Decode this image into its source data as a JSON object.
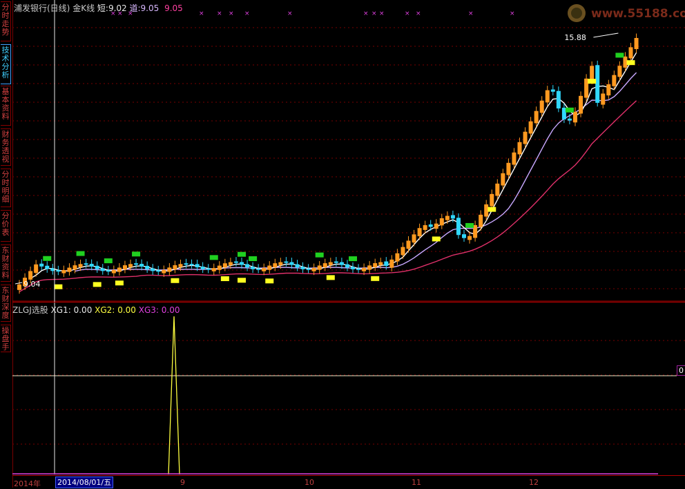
{
  "sidebar": {
    "tabs": [
      {
        "label": "分时走势",
        "active": false
      },
      {
        "label": "技术分析",
        "active": true
      },
      {
        "label": "基本资料",
        "active": false
      },
      {
        "label": "财务透视",
        "active": false
      },
      {
        "label": "分时明细",
        "active": false
      },
      {
        "label": "分价表",
        "active": false
      },
      {
        "label": "东财资料",
        "active": false
      },
      {
        "label": "东财深度",
        "active": false
      },
      {
        "label": "操盘手",
        "active": false
      }
    ]
  },
  "main": {
    "stock_title": "浦发银行(日线)",
    "indicator_name": "金K线",
    "short_label": "短:",
    "short_value": "9.02",
    "dao_label": "道:",
    "dao_value": "9.05",
    "third_value": "9.05",
    "high_marker": "15.88",
    "low_marker": "9.04"
  },
  "indicator": {
    "name": "ZLGJ选股",
    "xg1_label": "XG1:",
    "xg1_value": "0.00",
    "xg2_label": "XG2:",
    "xg2_value": "0.00",
    "xg3_label": "XG3:",
    "xg3_value": "0.00",
    "right_value": "0"
  },
  "xaxis": {
    "year_label": "2014年",
    "cursor_date": "2014/08/01/五",
    "months": [
      "9",
      "10",
      "11",
      "12"
    ]
  },
  "logo": {
    "text": "www.55188.com"
  },
  "colors": {
    "up": "#ff9a20",
    "down": "#30d8ff",
    "ma1": "#ffffff",
    "ma2": "#c8a8ff",
    "ma3": "#e0306a",
    "green_mark": "#20d020",
    "yellow_mark": "#ffff20",
    "grid": "#7a0000"
  },
  "chart_data": {
    "type": "candlestick",
    "title": "浦发银行(日线)",
    "price_range": [
      9.04,
      15.88
    ],
    "series": [
      {
        "name": "短",
        "last": 9.02
      },
      {
        "name": "道",
        "last": 9.05
      }
    ],
    "indicator_series": [
      {
        "name": "XG1",
        "last": 0.0
      },
      {
        "name": "XG2",
        "last": 0.0
      },
      {
        "name": "XG3",
        "last": 0.0
      }
    ],
    "x_ticks": [
      "2014年",
      "9",
      "10",
      "11",
      "12"
    ]
  }
}
